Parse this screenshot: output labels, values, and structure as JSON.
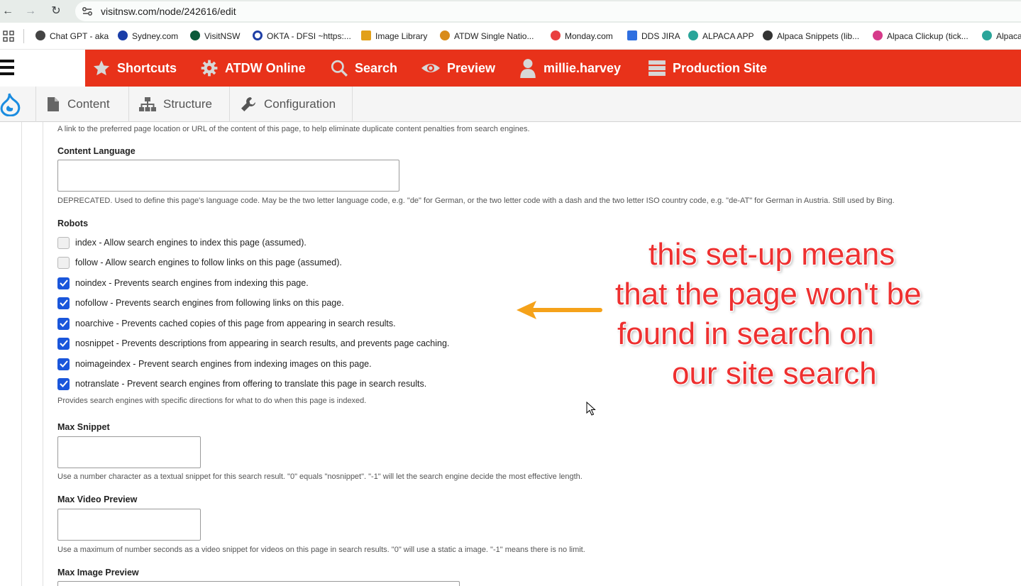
{
  "browser": {
    "url": "visitnsw.com/node/242616/edit",
    "bookmarks": [
      {
        "label": "Chat GPT - aka",
        "color": "#444444"
      },
      {
        "label": "Sydney.com",
        "color": "#1a3ea8"
      },
      {
        "label": "VisitNSW",
        "color": "#0b5a3a"
      },
      {
        "label": "OKTA - DFSI ~https:...",
        "color": "#1f3fa6"
      },
      {
        "label": "Image Library",
        "color": "#e2a019"
      },
      {
        "label": "ATDW Single Natio...",
        "color": "#d98b19"
      },
      {
        "label": "Monday.com",
        "color": "#e94040"
      },
      {
        "label": "DDS JIRA",
        "color": "#2f6fe0"
      },
      {
        "label": "ALPACA APP",
        "color": "#2aa59a"
      },
      {
        "label": "Alpaca Snippets (lib...",
        "color": "#333333"
      },
      {
        "label": "Alpaca Clickup (tick...",
        "color": "#d63a8a"
      },
      {
        "label": "Alpaca",
        "color": "#2aa59a"
      }
    ]
  },
  "toolbar": {
    "items": [
      {
        "label": "Shortcuts",
        "icon": "star-icon"
      },
      {
        "label": "ATDW Online",
        "icon": "gear-icon"
      },
      {
        "label": "Search",
        "icon": "search-icon"
      },
      {
        "label": "Preview",
        "icon": "eye-icon"
      },
      {
        "label": "millie.harvey",
        "icon": "user-icon"
      },
      {
        "label": "Production Site",
        "icon": "server-icon"
      }
    ],
    "tray": [
      {
        "label": "Content",
        "icon": "page-icon"
      },
      {
        "label": "Structure",
        "icon": "sitemap-icon"
      },
      {
        "label": "Configuration",
        "icon": "wrench-icon"
      }
    ]
  },
  "form": {
    "canonical_desc": "A link to the preferred page location or URL of the content of this page, to help eliminate duplicate content penalties from search engines.",
    "content_language": {
      "label": "Content Language",
      "value": "",
      "desc": "DEPRECATED. Used to define this page's language code. May be the two letter language code, e.g. \"de\" for German, or the two letter code with a dash and the two letter ISO country code, e.g. \"de-AT\" for German in Austria. Still used by Bing."
    },
    "robots": {
      "label": "Robots",
      "options": [
        {
          "label": "index - Allow search engines to index this page (assumed).",
          "checked": false
        },
        {
          "label": "follow - Allow search engines to follow links on this page (assumed).",
          "checked": false
        },
        {
          "label": "noindex - Prevents search engines from indexing this page.",
          "checked": true
        },
        {
          "label": "nofollow - Prevents search engines from following links on this page.",
          "checked": true
        },
        {
          "label": "noarchive - Prevents cached copies of this page from appearing in search results.",
          "checked": true
        },
        {
          "label": "nosnippet - Prevents descriptions from appearing in search results, and prevents page caching.",
          "checked": true
        },
        {
          "label": "noimageindex - Prevent search engines from indexing images on this page.",
          "checked": true
        },
        {
          "label": "notranslate - Prevent search engines from offering to translate this page in search results.",
          "checked": true
        }
      ],
      "desc": "Provides search engines with specific directions for what to do when this page is indexed."
    },
    "max_snippet": {
      "label": "Max Snippet",
      "value": "",
      "desc": "Use a number character as a textual snippet for this search result. \"0\" equals \"nosnippet\". \"-1\" will let the search engine decide the most effective length."
    },
    "max_video_preview": {
      "label": "Max Video Preview",
      "value": "",
      "desc": "Use a maximum of number seconds as a video snippet for videos on this page in search results. \"0\" will use a static a image. \"-1\" means there is no limit."
    },
    "max_image_preview": {
      "label": "Max Image Preview"
    }
  },
  "annotation": {
    "lines": [
      "this set-up means",
      "that the page won't be",
      "found in search on",
      "our site search"
    ],
    "text_color": "#ee3030",
    "arrow_color": "#f5a21a"
  }
}
